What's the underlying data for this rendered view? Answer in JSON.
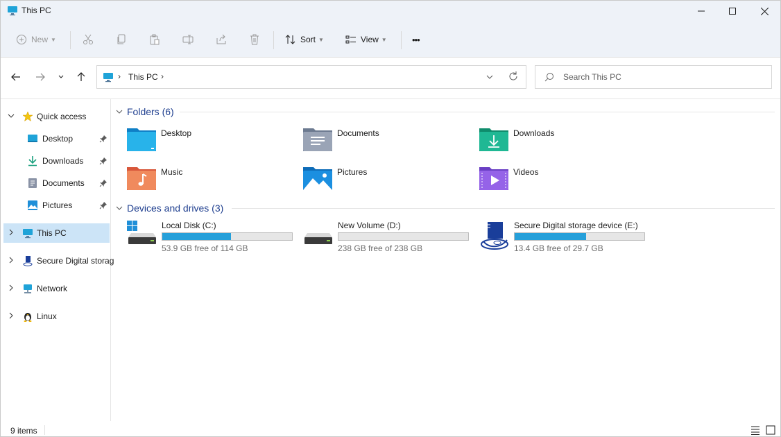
{
  "window": {
    "title": "This PC"
  },
  "toolbar": {
    "new_label": "New",
    "sort_label": "Sort",
    "view_label": "View",
    "more_label": "•••"
  },
  "address": {
    "path": "This PC"
  },
  "search": {
    "placeholder": "Search This PC"
  },
  "sidebar": {
    "items": [
      {
        "label": "Quick access"
      },
      {
        "label": "Desktop"
      },
      {
        "label": "Downloads"
      },
      {
        "label": "Documents"
      },
      {
        "label": "Pictures"
      },
      {
        "label": "This PC"
      },
      {
        "label": "Secure Digital storag"
      },
      {
        "label": "Network"
      },
      {
        "label": "Linux"
      }
    ]
  },
  "folders": {
    "header": "Folders (6)",
    "items": [
      {
        "name": "Desktop"
      },
      {
        "name": "Documents"
      },
      {
        "name": "Downloads"
      },
      {
        "name": "Music"
      },
      {
        "name": "Pictures"
      },
      {
        "name": "Videos"
      }
    ]
  },
  "drives": {
    "header": "Devices and drives (3)",
    "items": [
      {
        "name": "Local Disk (C:)",
        "free": "53.9 GB free of 114 GB",
        "used_fraction": 0.527
      },
      {
        "name": "New Volume (D:)",
        "free": "238 GB free of 238 GB",
        "used_fraction": 0.0
      },
      {
        "name": "Secure Digital storage device (E:)",
        "free": "13.4 GB free of 29.7 GB",
        "used_fraction": 0.549
      }
    ]
  },
  "status": {
    "count": "9 items"
  },
  "colors": {
    "accent": "#26a0da",
    "selection": "#cce4f7",
    "section_header": "#1f3f8f"
  }
}
